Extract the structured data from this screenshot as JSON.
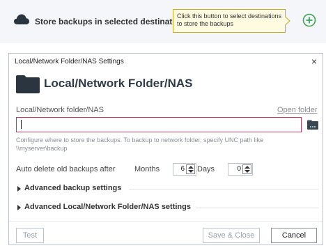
{
  "top": {
    "title": "Store backups in selected destinations",
    "tooltip": "Click this button to select destinations to store the backups",
    "add_icon": "plus-circle-icon",
    "cloud_icon": "cloud-icon",
    "accent": "#3aa655"
  },
  "dialog": {
    "title": "Local/Network Folder/NAS Settings",
    "heading": "Local/Network Folder/NAS",
    "folder_icon": "folder-icon",
    "field_label": "Local/Network folder/NAS",
    "open_folder": "Open folder",
    "path_value": "",
    "hint": "Configure where to store the backups. To backup to network folder, specify UNC path like \\\\myserver\\backup",
    "auto_delete_label": "Auto delete old backups after",
    "months_label": "Months",
    "months_value": "6",
    "days_label": "Days",
    "days_value": "0",
    "advanced_backup": "Advanced backup settings",
    "advanced_nas": "Advanced Local/Network Folder/NAS settings",
    "test_label": "Test",
    "save_close_label": "Save & Close",
    "cancel_label": "Cancel",
    "close_glyph": "×",
    "error_border": "#c8375a"
  }
}
